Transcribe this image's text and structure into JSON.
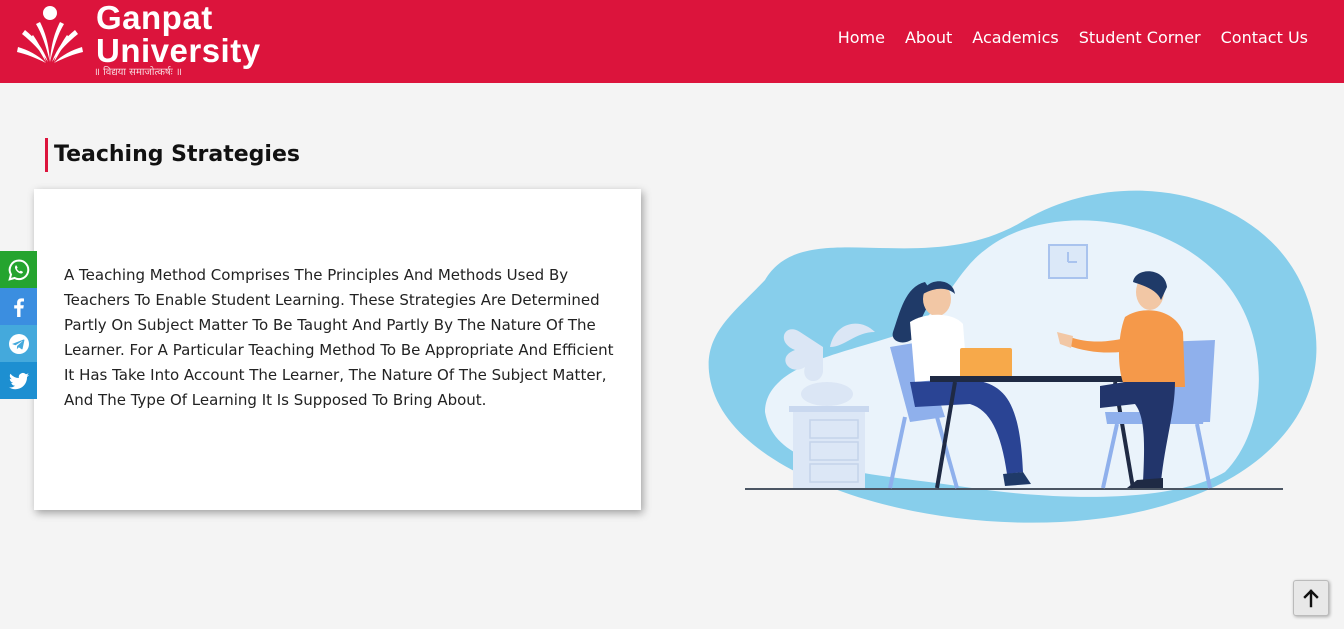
{
  "brand": {
    "name_line1": "Ganpat",
    "name_line2": "University",
    "tagline": "॥ विद्यया समाजोत्कर्षः ॥",
    "brand_color": "#dc143c"
  },
  "nav": {
    "items": [
      "Home",
      "About",
      "Academics",
      "Student Corner",
      "Contact Us"
    ]
  },
  "section": {
    "title": "Teaching Strategies",
    "body": "A Teaching Method Comprises The Principles And Methods Used By Teachers To Enable Student Learning. These Strategies Are Determined Partly On Subject Matter To Be Taught And Partly By The Nature Of The Learner. For A Particular Teaching Method To Be Appropriate And Efficient It Has Take Into Account The Learner, The Nature Of The Subject Matter, And The Type Of Learning It Is Supposed To Bring About."
  },
  "share": {
    "icons": [
      "whatsapp-icon",
      "facebook-icon",
      "telegram-icon",
      "twitter-icon"
    ],
    "colors": {
      "whatsapp": "#25a42f",
      "facebook": "#3b8ee0",
      "telegram": "#44a9dc",
      "twitter": "#1d8fd1"
    }
  },
  "scroll_top": {
    "icon": "arrow-up-icon"
  }
}
